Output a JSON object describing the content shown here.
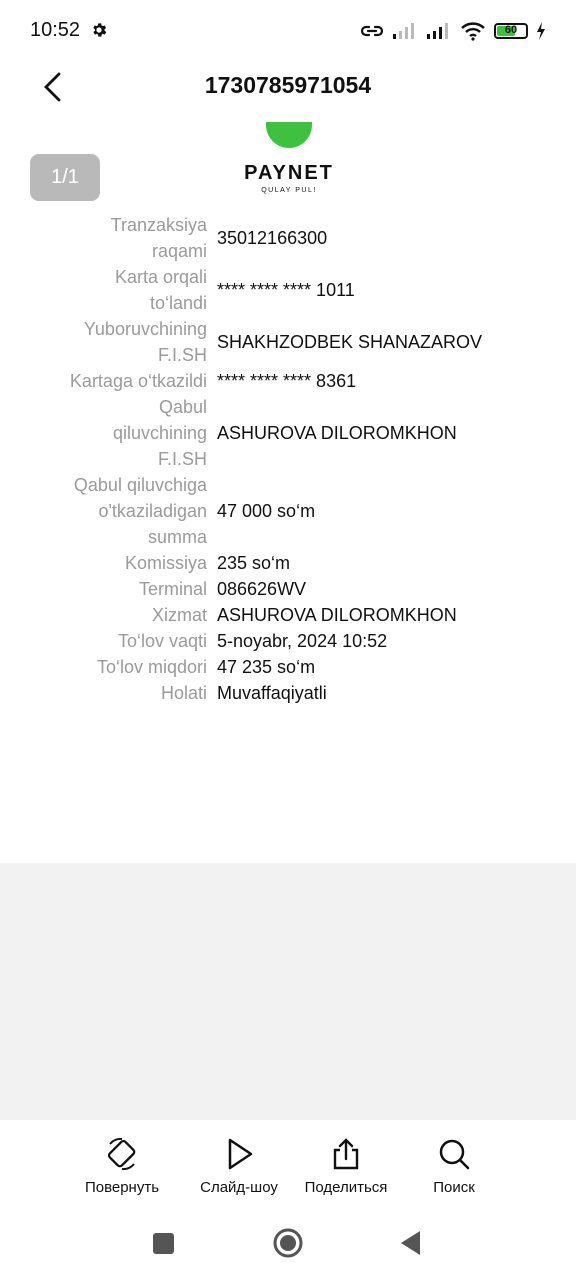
{
  "status_bar": {
    "time": "10:52",
    "battery_level": "60"
  },
  "header": {
    "title": "1730785971054"
  },
  "counter": "1/1",
  "logo": {
    "name": "PAYNET",
    "tagline": "QULAY PUL!",
    "color": "#3ec13e"
  },
  "receipt": [
    {
      "label": "Tranzaksiya raqami",
      "value": "35012166300"
    },
    {
      "label": "Karta orqali to‘landi",
      "value": "**** **** **** 1011"
    },
    {
      "label": "Yuboruvchining F.I.SH",
      "value": "SHAKHZODBEK SHANAZAROV"
    },
    {
      "label": "Kartaga o‘tkazildi",
      "value": "**** **** **** 8361"
    },
    {
      "label": "Qabul qiluvchining F.I.SH",
      "value": "ASHUROVA DILOROMKHON"
    },
    {
      "label": "Qabul qiluvchiga o'tkaziladigan summa",
      "value": "47 000 so‘m"
    },
    {
      "label": "Komissiya",
      "value": "235 so‘m"
    },
    {
      "label": "Terminal",
      "value": "086626WV"
    },
    {
      "label": "Xizmat",
      "value": "ASHUROVA DILOROMKHON"
    },
    {
      "label": "To‘lov vaqti",
      "value": "5-noyabr, 2024 10:52"
    },
    {
      "label": "To‘lov miqdori",
      "value": "47 235 so‘m"
    },
    {
      "label": "Holati",
      "value": "Muvaffaqiyatli"
    }
  ],
  "toolbar": {
    "rotate": "Повернуть",
    "slideshow": "Слайд-шоу",
    "share": "Поделиться",
    "search": "Поиск"
  }
}
